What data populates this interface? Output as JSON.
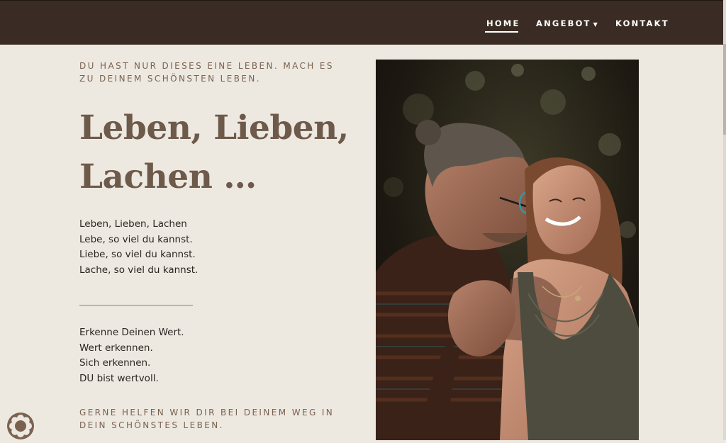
{
  "nav": {
    "items": [
      {
        "label": "HOME",
        "active": true
      },
      {
        "label": "ANGEBOT",
        "has_dropdown": true
      },
      {
        "label": "KONTAKT"
      }
    ]
  },
  "hero": {
    "eyebrow": "DU HAST NUR DIESES EINE LEBEN. MACH ES ZU DEINEM SCHÖNSTEN LEBEN.",
    "headline_line1": "Leben, Lieben,",
    "headline_line2": "Lachen …",
    "block1": [
      "Leben, Lieben, Lachen",
      "Lebe, so viel du kannst.",
      "Liebe, so viel du kannst.",
      "Lache, so viel du kannst."
    ],
    "block2": [
      "Erkenne Deinen Wert.",
      "Wert erkennen.",
      "Sich erkennen.",
      "DU bist wertvoll."
    ],
    "cta_eyebrow": "GERNE HELFEN WIR DIR BEI DEINEM WEG IN DEIN SCHÖNSTES LEBEN."
  },
  "photo": {
    "icon": "couple-photo"
  },
  "cookie_badge": {
    "icon": "cookie-flower-icon"
  },
  "colors": {
    "navbar": "#3a2c24",
    "background": "#ede9e1",
    "accent_brown": "#7a6250",
    "headline": "#6e5a4a",
    "body_text": "#2d2420"
  }
}
